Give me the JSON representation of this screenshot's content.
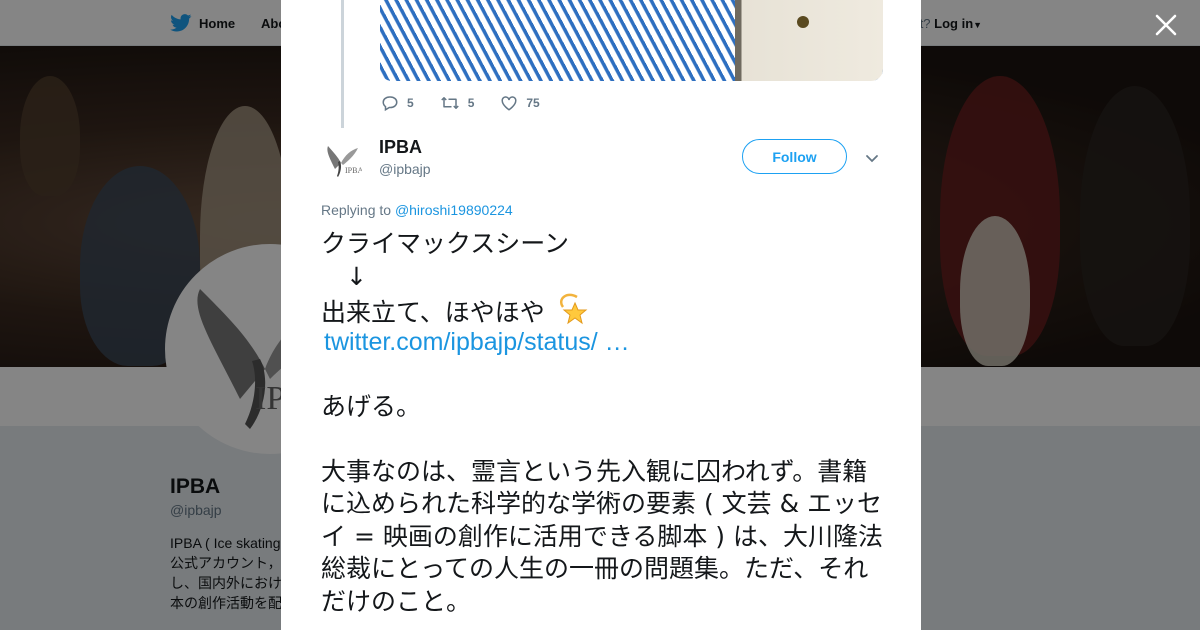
{
  "nav": {
    "home_label": "Home",
    "about_label": "Abo",
    "account_prompt": "ccount?",
    "login_label": "Log in"
  },
  "profile": {
    "name": "IPBA",
    "handle": "@ipbajp",
    "bio_lines": [
      "IPBA ( Ice skating",
      "公式アカウント，",
      "し、国内外におけ",
      "本の創作活動を配"
    ]
  },
  "prev_tweet": {
    "replies": "5",
    "retweets": "5",
    "likes": "75"
  },
  "tweet": {
    "author_name": "IPBA",
    "author_handle": "@ipbajp",
    "follow_label": "Follow",
    "replying_prefix": "Replying to",
    "replying_to": "@hiroshi19890224",
    "line1": "クライマックスシーン",
    "line2": "　↓",
    "line3": "出来立て、ほやほや",
    "link": "twitter.com/ipbajp/status/ …",
    "line5": "",
    "line6": "あげる。",
    "line7": "",
    "para": "大事なのは、霊言という先入観に囚われず。書籍に込められた科学的な学術の要素 ( 文芸 & エッセイ = 映画の創作に活用できる脚本 ) は、大川隆法総裁にとっての人生の一冊の問題集。ただ、それだけのこと。"
  },
  "colors": {
    "accent": "#1da1f2",
    "link": "#1b95e0",
    "text": "#14171a",
    "muted": "#657786"
  },
  "icons": [
    "twitter-bird-icon",
    "close-icon",
    "reply-icon",
    "retweet-icon",
    "like-icon",
    "chevron-down-icon",
    "dizzy-emoji-icon"
  ]
}
